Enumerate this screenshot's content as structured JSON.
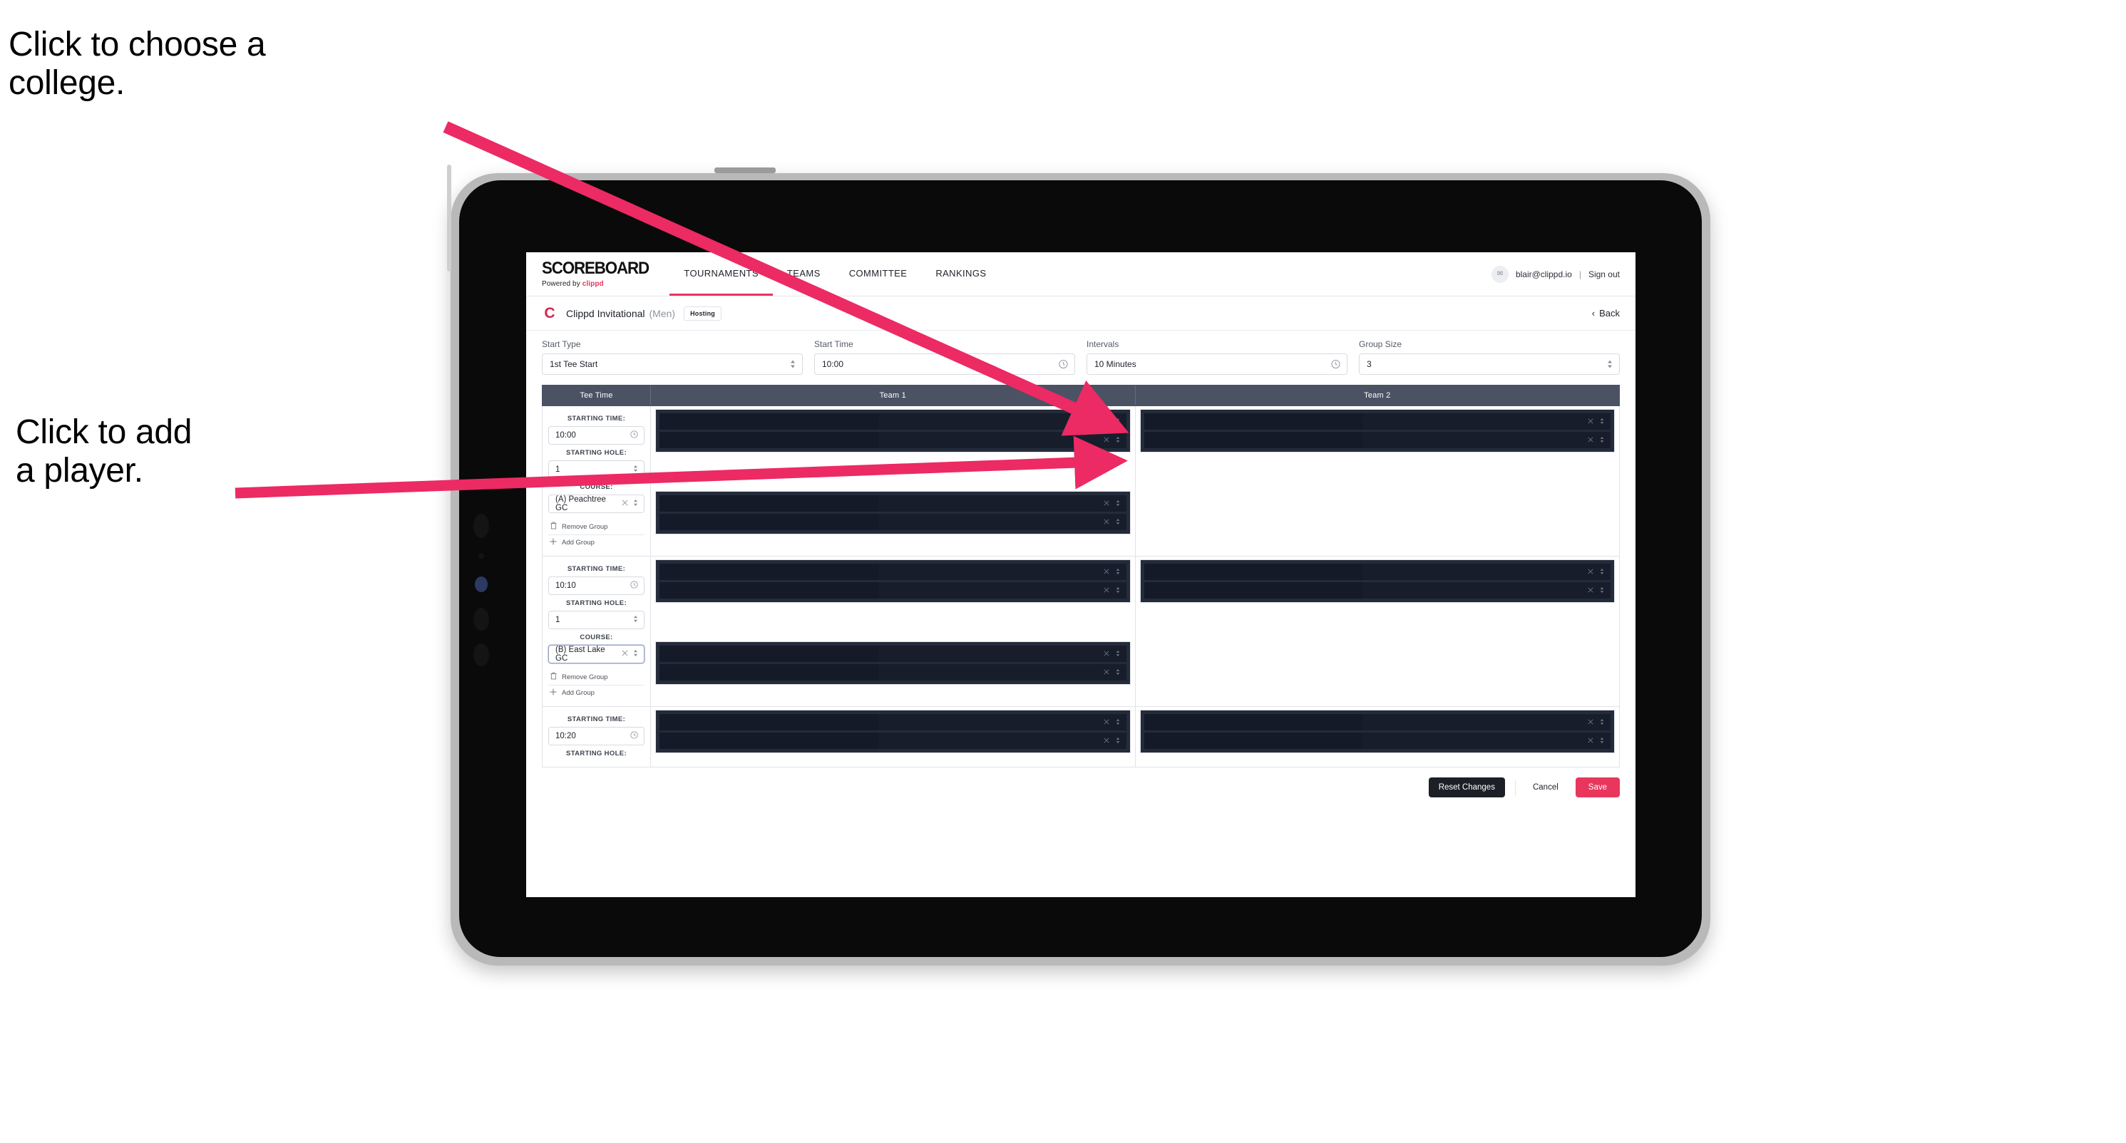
{
  "annotations": [
    {
      "id": "choose-college",
      "text": "Click to choose a\ncollege."
    },
    {
      "id": "add-player",
      "text": "Click to add\na player."
    }
  ],
  "colors": {
    "accent": "#e8365d",
    "table_header": "#4b5263",
    "redacted_row": "#171d2b",
    "redacted_block": "#242b3a",
    "dark_button": "#1c1f26"
  },
  "app": {
    "topnav": {
      "brand_word": "SCOREBOARD",
      "brand_sub_prefix": "Powered by",
      "brand_sub_accent": "clippd",
      "tabs": [
        {
          "label": "TOURNAMENTS",
          "active": true
        },
        {
          "label": "TEAMS",
          "active": false
        },
        {
          "label": "COMMITTEE",
          "active": false
        },
        {
          "label": "RANKINGS",
          "active": false
        }
      ],
      "avatar_glyph": "✉",
      "user_email": "blair@clippd.io",
      "separator": "|",
      "sign_out": "Sign out"
    },
    "eventbar": {
      "logo_letter": "C",
      "event_name": "Clippd Invitational",
      "gender": "(Men)",
      "badge": "Hosting",
      "back_chevron": "‹",
      "back_label": "Back"
    },
    "controls": [
      {
        "label": "Start Type",
        "value": "1st Tee Start",
        "icon": "stepper-icon",
        "glyph": "⌃⌄"
      },
      {
        "label": "Start Time",
        "value": "10:00",
        "icon": "clock-icon",
        "glyph": "◴"
      },
      {
        "label": "Intervals",
        "value": "10 Minutes",
        "icon": "clock-icon",
        "glyph": "◴"
      },
      {
        "label": "Group Size",
        "value": "3",
        "icon": "stepper-icon",
        "glyph": "⌃⌄"
      }
    ],
    "table": {
      "headers": [
        "Tee Time",
        "Team 1",
        "Team 2"
      ],
      "field_labels": {
        "starting_time": "STARTING TIME:",
        "starting_hole": "STARTING HOLE:",
        "course": "COURSE:"
      },
      "group_actions": {
        "remove": "Remove Group",
        "remove_icon": "trash-icon",
        "remove_glyph": "☐",
        "add": "Add Group",
        "add_icon": "plus-icon",
        "add_glyph": "+"
      },
      "row_icons": {
        "clear_glyph": "✕",
        "stepper_glyph": "⌃⌄"
      },
      "groups": [
        {
          "starting_time": "10:00",
          "starting_hole": "1",
          "course": "(A) Peachtree GC",
          "course_focused": false,
          "team1_blocks": [
            2,
            2
          ],
          "team2_blocks": [
            2
          ]
        },
        {
          "starting_time": "10:10",
          "starting_hole": "1",
          "course": "(B) East Lake GC",
          "course_focused": true,
          "team1_blocks": [
            2,
            2
          ],
          "team2_blocks": [
            2
          ]
        },
        {
          "starting_time": "10:20",
          "starting_hole": "",
          "course": "",
          "course_focused": false,
          "team1_blocks": [
            2
          ],
          "team2_blocks": [
            2
          ]
        }
      ]
    },
    "footer": {
      "reset": "Reset Changes",
      "cancel": "Cancel",
      "save": "Save"
    }
  }
}
